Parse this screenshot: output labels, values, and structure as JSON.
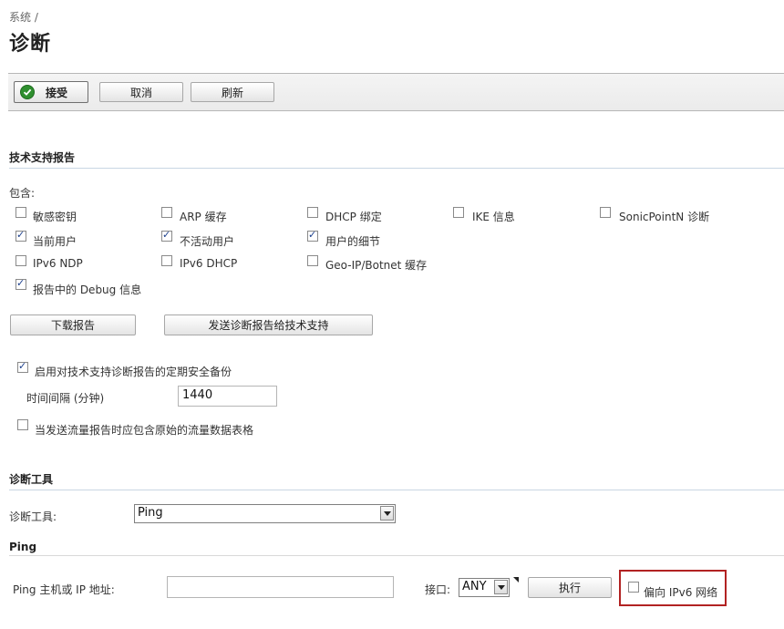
{
  "breadcrumb": "系统 /",
  "page_title": "诊断",
  "toolbar": {
    "accept_label": "接受",
    "cancel_label": "取消",
    "refresh_label": "刷新"
  },
  "tech_support": {
    "section_title": "技术支持报告",
    "include_label": "包含:",
    "options": [
      {
        "label": "敏感密钥",
        "checked": false
      },
      {
        "label": "ARP 缓存",
        "checked": false
      },
      {
        "label": "DHCP 绑定",
        "checked": false
      },
      {
        "label": "IKE 信息",
        "checked": false
      },
      {
        "label": "SonicPointN 诊断",
        "checked": false
      },
      {
        "label": "当前用户",
        "checked": true
      },
      {
        "label": "不活动用户",
        "checked": true
      },
      {
        "label": "用户的细节",
        "checked": true
      },
      {
        "label": "IPv6 NDP",
        "checked": false
      },
      {
        "label": "IPv6 DHCP",
        "checked": false
      },
      {
        "label": "Geo-IP/Botnet 缓存",
        "checked": false
      },
      {
        "label": "报告中的 Debug 信息",
        "checked": true
      }
    ],
    "download_label": "下载报告",
    "send_label": "发送诊断报告给技术支持",
    "periodic_backup_label": "启用对技术支持诊断报告的定期安全备份",
    "periodic_backup_checked": true,
    "interval_label": "时间间隔 (分钟)",
    "interval_value": "1440",
    "raw_flow_label": "当发送流量报告时应包含原始的流量数据表格",
    "raw_flow_checked": false
  },
  "diag_tools": {
    "section_title": "诊断工具",
    "tool_label": "诊断工具:",
    "tool_value": "Ping",
    "ping_section": "Ping",
    "host_label": "Ping 主机或 IP 地址:",
    "host_value": "",
    "interface_label": "接口:",
    "interface_value": "ANY",
    "execute_label": "执行",
    "prefer_ipv6_label": "偏向 IPv6 网络",
    "prefer_ipv6_checked": false
  }
}
